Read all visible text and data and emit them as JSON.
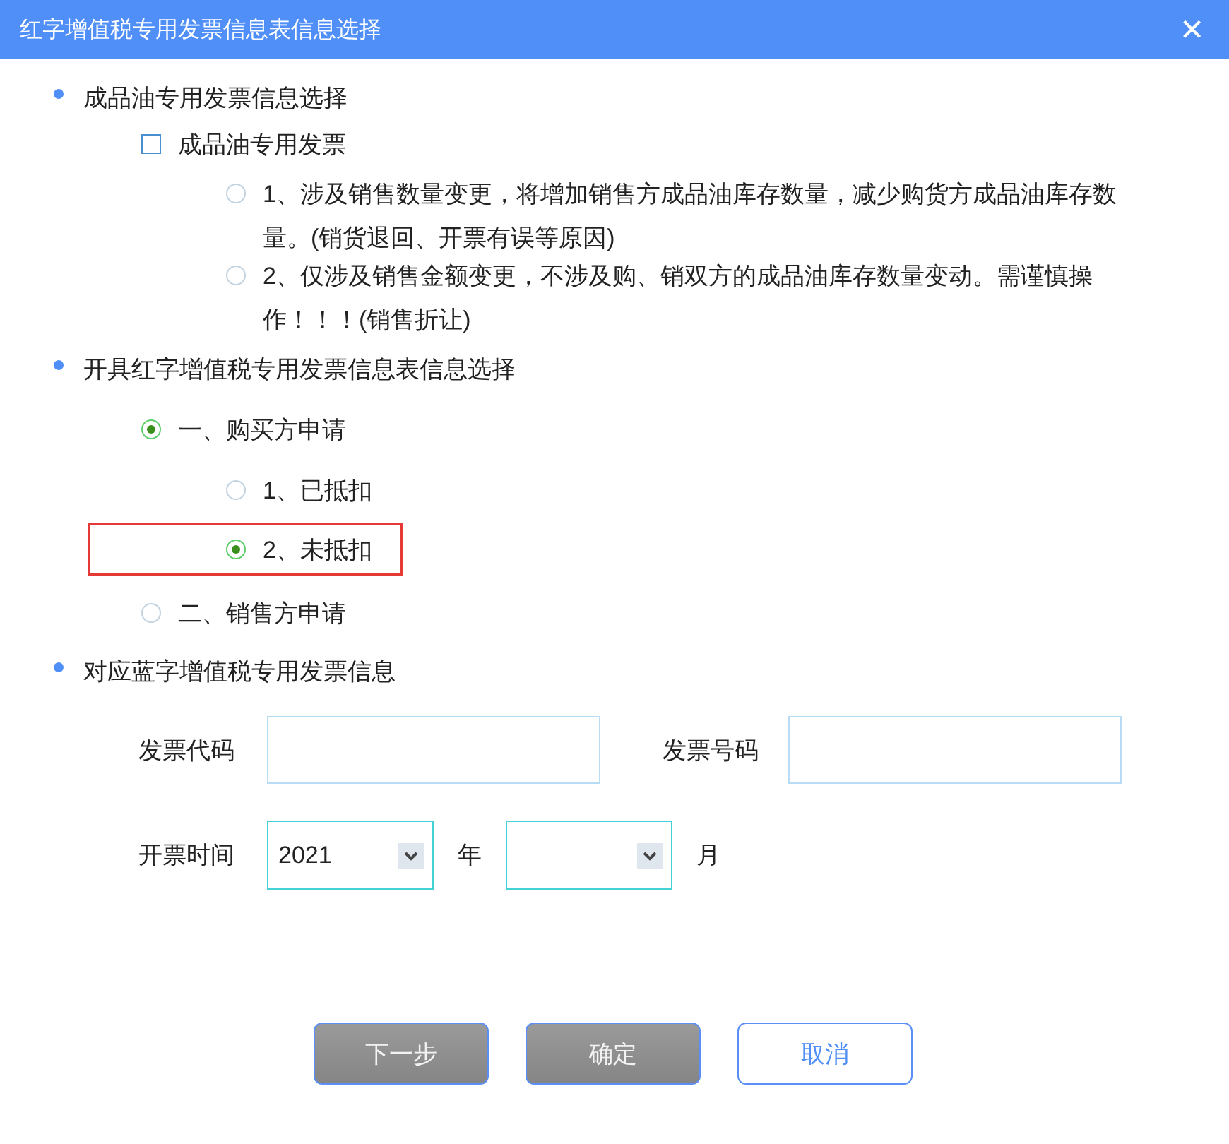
{
  "window": {
    "title": "红字增值税专用发票信息表信息选择",
    "close": "×"
  },
  "sections": [
    {
      "heading": "成品油专用发票信息选择",
      "items": [
        {
          "kind": "checkbox",
          "label": "成品油专用发票",
          "checked": false,
          "children": [
            {
              "kind": "radio",
              "label": "1、涉及销售数量变更，将增加销售方成品油库存数量，减少购货方成品油库存数量。(销货退回、开票有误等原因)",
              "selected": false
            },
            {
              "kind": "radio",
              "label": "2、仅涉及销售金额变更，不涉及购、销双方的成品油库存数量变动。需谨慎操作！！！(销售折让)",
              "selected": false
            }
          ]
        }
      ]
    },
    {
      "heading": "开具红字增值税专用发票信息表信息选择",
      "items": [
        {
          "kind": "radio",
          "label": "一、购买方申请",
          "selected": true,
          "children": [
            {
              "kind": "radio",
              "label": "1、已抵扣",
              "selected": false
            },
            {
              "kind": "radio",
              "label": "2、未抵扣",
              "selected": true,
              "highlighted": true
            }
          ]
        },
        {
          "kind": "radio",
          "label": "二、销售方申请",
          "selected": false
        }
      ]
    },
    {
      "heading": "对应蓝字增值税专用发票信息",
      "fields": [
        {
          "label": "发票代码"
        },
        {
          "label": "发票号码"
        }
      ],
      "date": {
        "label": "开票时间",
        "year": "2021",
        "year_unit": "年",
        "month_unit": "月"
      }
    }
  ],
  "buttons": [
    {
      "label": "下一步",
      "kind": "grey"
    },
    {
      "label": "确定",
      "kind": "grey"
    },
    {
      "label": "取消",
      "kind": "outline"
    }
  ]
}
